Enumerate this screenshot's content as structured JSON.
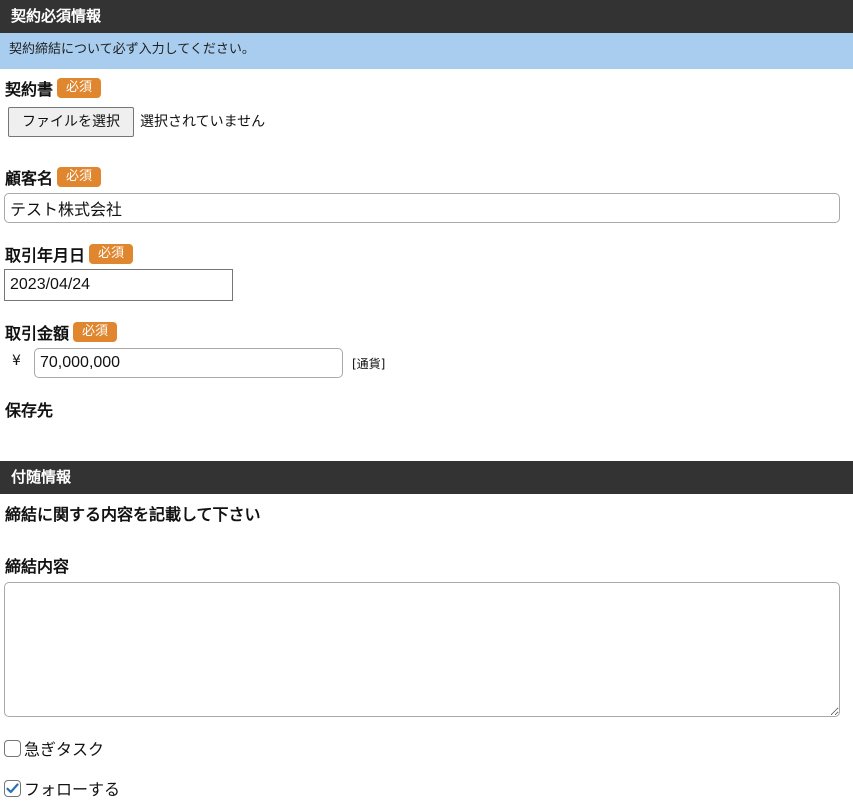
{
  "required_section": {
    "title": "契約必須情報",
    "notice": "契約締結について必ず入力してください。",
    "required_badge": "必須"
  },
  "contract_file": {
    "label": "契約書",
    "button_label": "ファイルを選択",
    "status": "選択されていません"
  },
  "customer_name": {
    "label": "顧客名",
    "value": "テスト株式会社"
  },
  "transaction_date": {
    "label": "取引年月日",
    "value": "2023/04/24"
  },
  "transaction_amount": {
    "label": "取引金額",
    "currency_symbol": "¥",
    "value": "70,000,000",
    "currency_link": "[通貨]"
  },
  "save_location": {
    "label": "保存先"
  },
  "supplementary_section": {
    "title": "付随情報",
    "description": "締結に関する内容を記載して下さい",
    "content_label": "締結内容",
    "content_value": ""
  },
  "checkboxes": [
    {
      "label": "急ぎタスク",
      "checked": false
    },
    {
      "label": "フォローする",
      "checked": true
    }
  ],
  "colors": {
    "header_bg": "#333333",
    "notice_bg": "#a8cdef",
    "required_badge_bg": "#e0862e",
    "checkbox_accent": "#2d6fb5"
  }
}
